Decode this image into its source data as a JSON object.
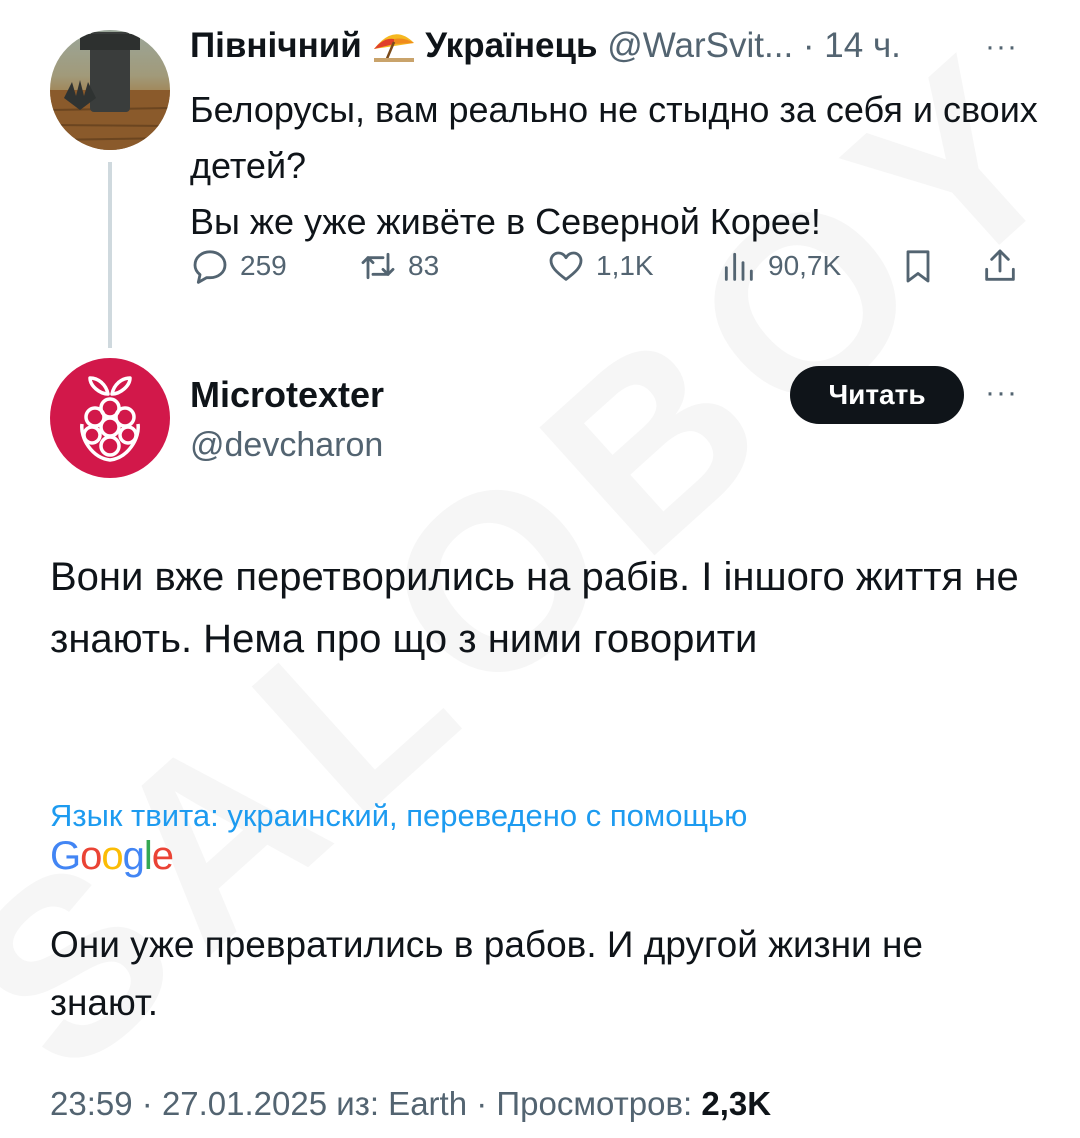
{
  "watermark": "SALOBOY",
  "parent_tweet": {
    "display_name_part1": "Північний",
    "display_name_emoji": "umbrella-on-ground-emoji",
    "display_name_part2": "Українець",
    "handle": "@WarSvit...",
    "separator": "·",
    "time": "14 ч.",
    "more": "···",
    "text_lines": [
      "Белорусы, вам реально не стыдно за себя и своих детей?",
      "Вы же уже живёте в Северной Корее!"
    ],
    "actions": {
      "replies": "259",
      "reposts": "83",
      "likes": "1,1K",
      "views": "90,7K"
    },
    "icons": [
      "reply-icon",
      "repost-icon",
      "like-icon",
      "views-icon",
      "bookmark-icon",
      "share-icon"
    ]
  },
  "main_tweet": {
    "display_name": "Microtexter",
    "handle": "@devcharon",
    "follow_button": "Читать",
    "more": "···",
    "avatar_icon": "raspberry-pi-logo",
    "text_lines": [
      "Вони вже перетворились на рабів. І іншого життя не знають. Нема про що з ними говорити"
    ],
    "translation_label": "Язык твита: украинский, переведено с помощью",
    "translation_provider": "Google",
    "translation_text": "Они уже превратились в рабов. И другой жизни не знают.",
    "meta": {
      "time": "23:59",
      "separator": "·",
      "date": "27.01.2025",
      "source": "из: Earth",
      "views_label": "Просмотров:",
      "views_count": "2,3K"
    }
  },
  "colors": {
    "text_primary": "#0f1419",
    "text_secondary": "#536471",
    "link": "#1d9bf0",
    "avatar_bg": "#d2184a",
    "button_bg": "#0f1419",
    "thread_line": "#cfd9de"
  }
}
